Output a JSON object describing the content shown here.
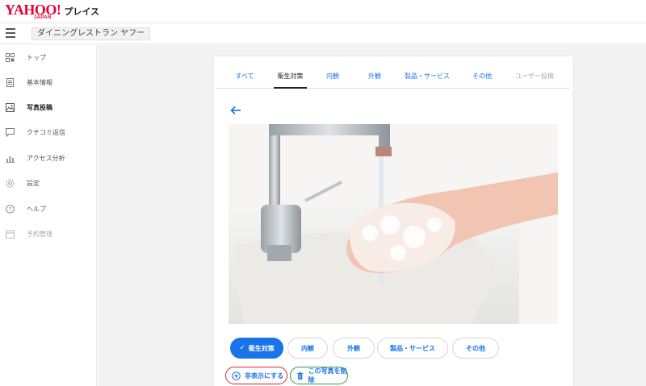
{
  "header": {
    "logo_text": "YAHOO!",
    "logo_sub": "JAPAN",
    "product": "プレイス",
    "shop_name": "ダイニングレストラン ヤフー"
  },
  "sidebar": {
    "items": [
      {
        "label": "トップ",
        "icon": "grid-icon"
      },
      {
        "label": "基本情報",
        "icon": "document-icon"
      },
      {
        "label": "写真投稿",
        "icon": "image-icon"
      },
      {
        "label": "クチコミ返信",
        "icon": "chat-icon"
      },
      {
        "label": "アクセス分析",
        "icon": "bar-chart-icon"
      },
      {
        "label": "設定",
        "icon": "gear-icon"
      },
      {
        "label": "ヘルプ",
        "icon": "help-icon"
      },
      {
        "label": "予約管理",
        "icon": "calendar-icon"
      }
    ]
  },
  "tabs": [
    {
      "label": "すべて"
    },
    {
      "label": "衛生対策"
    },
    {
      "label": "内観"
    },
    {
      "label": "外観"
    },
    {
      "label": "製品・サービス"
    },
    {
      "label": "その他"
    },
    {
      "label": "ユーザー投稿"
    }
  ],
  "categories": [
    {
      "label": "衛生対策"
    },
    {
      "label": "内観"
    },
    {
      "label": "外観"
    },
    {
      "label": "製品・サービス"
    },
    {
      "label": "その他"
    }
  ],
  "actions": {
    "hide_label": "非表示にする",
    "delete_label": "この写真を削除"
  },
  "colors": {
    "accent": "#1a73e8",
    "hide_outline": "#d9262c",
    "delete_outline": "#2e9b45",
    "brand": "#e60033"
  }
}
